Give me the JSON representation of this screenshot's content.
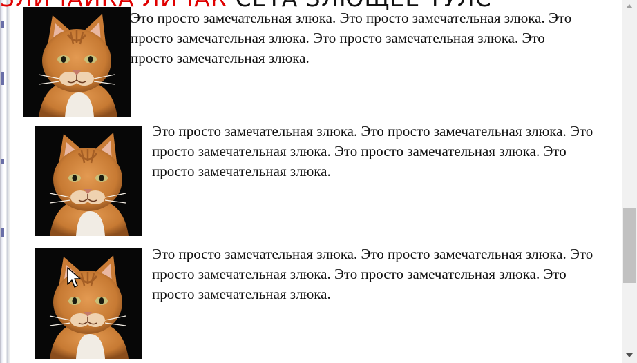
{
  "header_overlay": {
    "red_text": "ЗЛИЧАЙКА ЛИЧАК",
    "black_text": "СЕТА ЗЛЮЩЕЕ ТУЛС"
  },
  "posts": [
    {
      "text": "Это просто замечательная злюка. Это просто замечательная злюка. Это просто замечательная злюка. Это просто замечательная злюка. Это просто замечательная злюка.",
      "image": "orange-cat-photo"
    },
    {
      "text": "Это просто замечательная злюка. Это просто замечательная злюка. Это просто замечательная злюка. Это просто замечательная злюка. Это просто замечательная злюка.",
      "image": "orange-cat-photo"
    },
    {
      "text": "Это просто замечательная злюка. Это просто замечательная злюка. Это просто замечательная злюка. Это просто замечательная злюка. Это просто замечательная злюка.",
      "image": "orange-cat-photo"
    }
  ],
  "scrollbar": {
    "position_fraction": 0.75
  },
  "colors": {
    "overlay_red": "#e00000",
    "cat_fur": "#d08a45",
    "background": "#ffffff"
  }
}
